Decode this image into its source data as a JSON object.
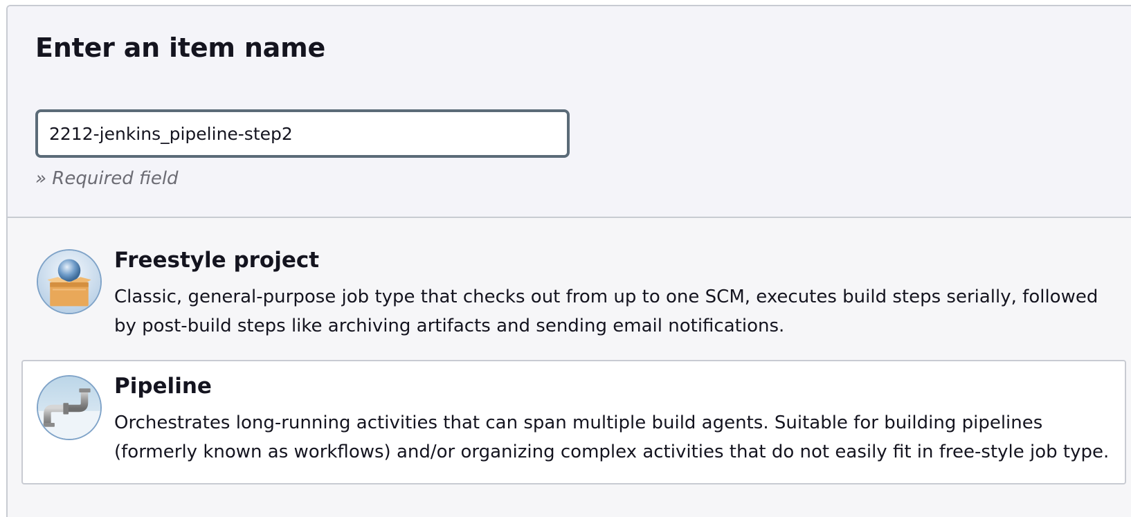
{
  "form": {
    "title": "Enter an item name",
    "item_name_value": "2212-jenkins_pipeline-step2",
    "required_hint": "» Required field"
  },
  "item_types": [
    {
      "name": "Freestyle project",
      "icon": "freestyle-project-icon",
      "description": "Classic, general-purpose job type that checks out from up to one SCM, executes build steps serially, followed by post-build steps like archiving artifacts and sending email notifications.",
      "selected": false
    },
    {
      "name": "Pipeline",
      "icon": "pipeline-icon",
      "description": "Orchestrates long-running activities that can span multiple build agents. Suitable for building pipelines (formerly known as workflows) and/or organizing complex activities that do not easily fit in free-style job type.",
      "selected": true
    }
  ]
}
